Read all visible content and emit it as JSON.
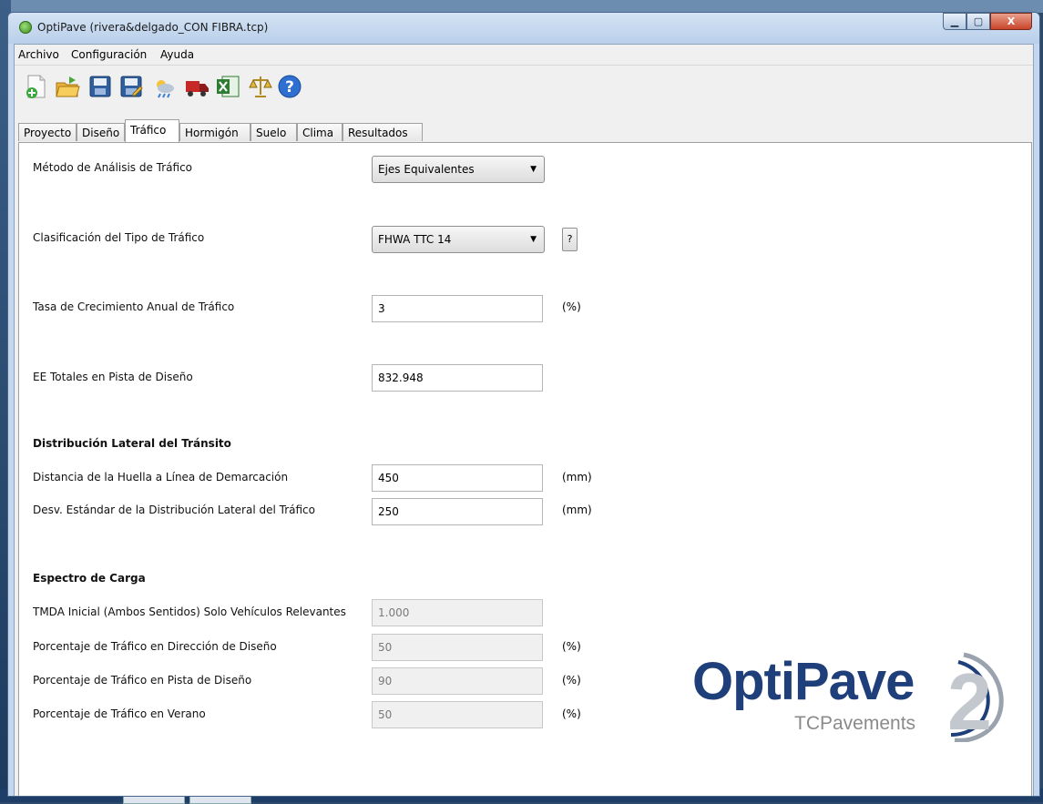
{
  "window": {
    "title": "OptiPave  (rivera&delgado_CON FIBRA.tcp)",
    "controls": {
      "minimize": "▁",
      "maximize": "▢",
      "close": "X"
    }
  },
  "menu": [
    "Archivo",
    "Configuración",
    "Ayuda"
  ],
  "toolbar": {
    "icons": [
      "new-file-icon",
      "open-folder-icon",
      "save-icon",
      "save-as-icon",
      "climate-icon",
      "truck-icon",
      "excel-icon",
      "scale-icon",
      "help-icon"
    ]
  },
  "tabs": [
    "Proyecto",
    "Diseño",
    "Tráfico",
    "Hormigón",
    "Suelo",
    "Clima",
    "Resultados"
  ],
  "active_tab": "Tráfico",
  "traffic": {
    "method_label": "Método de Análisis de Tráfico",
    "method_value": "Ejes Equivalentes",
    "classification_label": "Clasificación del Tipo de Tráfico",
    "classification_value": "FHWA TTC 14",
    "classification_help": "?",
    "growth_label": "Tasa de Crecimiento Anual de Tráfico",
    "growth_value": "3",
    "growth_unit": "(%)",
    "ee_label": "EE Totales en Pista de Diseño",
    "ee_value": "832.948"
  },
  "lateral": {
    "heading": "Distribución Lateral del Tránsito",
    "distance_label": "Distancia de la Huella a Línea de Demarcación",
    "distance_value": "450",
    "distance_unit": "(mm)",
    "stddev_label": "Desv. Estándar de la Distribución Lateral del Tráfico",
    "stddev_value": "250",
    "stddev_unit": "(mm)"
  },
  "spectrum": {
    "heading": "Espectro de Carga",
    "tmda_label": "TMDA Inicial (Ambos Sentidos) Solo Vehículos Relevantes",
    "tmda_value": "1.000",
    "direction_label": "Porcentaje de Tráfico en Dirección de Diseño",
    "direction_value": "50",
    "direction_unit": "(%)",
    "lane_label": "Porcentaje de Tráfico en Pista de Diseño",
    "lane_value": "90",
    "lane_unit": "(%)",
    "summer_label": "Porcentaje de Tráfico en Verano",
    "summer_value": "50",
    "summer_unit": "(%)"
  },
  "logo": {
    "main": "OptiPave",
    "number": "2",
    "sub": "TCPavements"
  },
  "colors": {
    "logo_blue": "#1f3f7a",
    "logo_gray": "#8a8a8a"
  }
}
